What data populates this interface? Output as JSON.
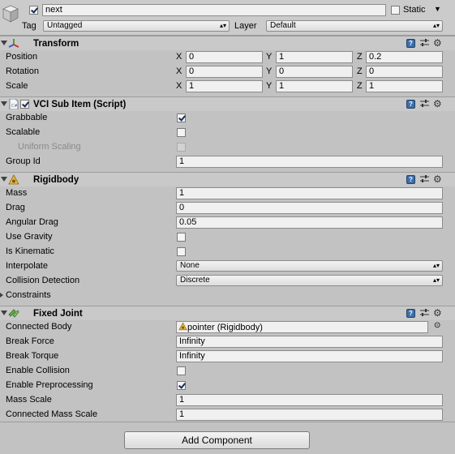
{
  "object": {
    "name": "next",
    "static_label": "Static",
    "tag_label": "Tag",
    "tag_value": "Untagged",
    "layer_label": "Layer",
    "layer_value": "Default"
  },
  "transform": {
    "title": "Transform",
    "position": {
      "label": "Position",
      "x": "0",
      "y": "1",
      "z": "0.2"
    },
    "rotation": {
      "label": "Rotation",
      "x": "0",
      "y": "0",
      "z": "0"
    },
    "scale": {
      "label": "Scale",
      "x": "1",
      "y": "1",
      "z": "1"
    },
    "axis_x": "X",
    "axis_y": "Y",
    "axis_z": "Z"
  },
  "vci": {
    "title": "VCI Sub Item (Script)",
    "grabbable_label": "Grabbable",
    "grabbable": true,
    "scalable_label": "Scalable",
    "scalable": false,
    "uniform_scaling_label": "Uniform Scaling",
    "uniform_scaling": false,
    "group_id_label": "Group Id",
    "group_id": "1"
  },
  "rigidbody": {
    "title": "Rigidbody",
    "mass_label": "Mass",
    "mass": "1",
    "drag_label": "Drag",
    "drag": "0",
    "angular_drag_label": "Angular Drag",
    "angular_drag": "0.05",
    "use_gravity_label": "Use Gravity",
    "use_gravity": false,
    "is_kinematic_label": "Is Kinematic",
    "is_kinematic": false,
    "interpolate_label": "Interpolate",
    "interpolate": "None",
    "collision_detection_label": "Collision Detection",
    "collision_detection": "Discrete",
    "constraints_label": "Constraints"
  },
  "fixed_joint": {
    "title": "Fixed Joint",
    "connected_body_label": "Connected Body",
    "connected_body": "pointer (Rigidbody)",
    "break_force_label": "Break Force",
    "break_force": "Infinity",
    "break_torque_label": "Break Torque",
    "break_torque": "Infinity",
    "enable_collision_label": "Enable Collision",
    "enable_collision": false,
    "enable_preprocessing_label": "Enable Preprocessing",
    "enable_preprocessing": true,
    "mass_scale_label": "Mass Scale",
    "mass_scale": "1",
    "connected_mass_scale_label": "Connected Mass Scale",
    "connected_mass_scale": "1"
  },
  "add_component_label": "Add Component",
  "colors": {
    "background": "#c2c2c2",
    "header": "#c9c9c9",
    "help_blue": "#3d6fa8"
  }
}
